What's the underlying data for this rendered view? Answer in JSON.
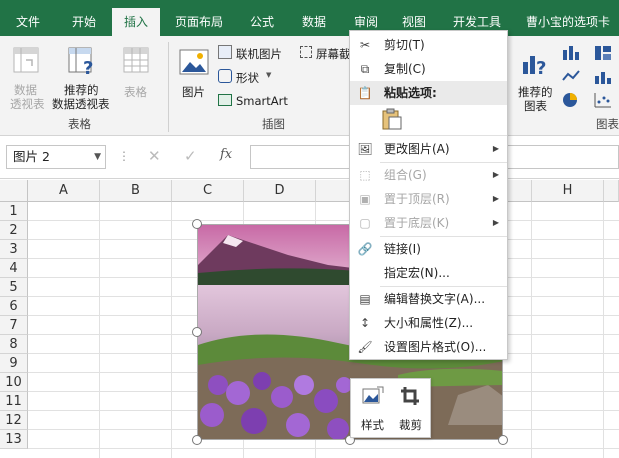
{
  "tabs": [
    "文件",
    "开始",
    "插入",
    "页面布局",
    "公式",
    "数据",
    "审阅",
    "视图",
    "开发工具",
    "曹小宝的选项卡"
  ],
  "active_tab": "插入",
  "ribbon": {
    "pivot_table": "数据\n透视表",
    "pivot_label_1": "数据",
    "pivot_label_2": "透视表",
    "rec_pivot_1": "推荐的",
    "rec_pivot_2": "数据透视表",
    "table": "表格",
    "group_tables": "表格",
    "picture": "图片",
    "online_pictures": "联机图片",
    "shapes": "形状",
    "smartart": "SmartArt",
    "screenshot": "屏幕截",
    "group_illustrations": "插图",
    "rec_charts_1": "推荐的",
    "rec_charts_2": "图表",
    "group_charts": "图表"
  },
  "formula_bar": {
    "name_box": "图片 2",
    "fx": "fx"
  },
  "columns": [
    "A",
    "B",
    "C",
    "D",
    "H"
  ],
  "rows": [
    "1",
    "2",
    "3",
    "4",
    "5",
    "6",
    "7",
    "8",
    "9",
    "10",
    "11",
    "12",
    "13"
  ],
  "context_menu": {
    "cut": "剪切(T)",
    "copy": "复制(C)",
    "paste_options": "粘贴选项:",
    "change_picture": "更改图片(A)",
    "group": "组合(G)",
    "bring_front": "置于顶层(R)",
    "send_back": "置于底层(K)",
    "link": "链接(I)",
    "assign_macro": "指定宏(N)...",
    "edit_alt_text": "编辑替换文字(A)...",
    "size_props": "大小和属性(Z)...",
    "format_picture": "设置图片格式(O)..."
  },
  "mini_toolbar": {
    "style": "样式",
    "crop": "裁剪"
  },
  "colors": {
    "accent": "#217346"
  }
}
